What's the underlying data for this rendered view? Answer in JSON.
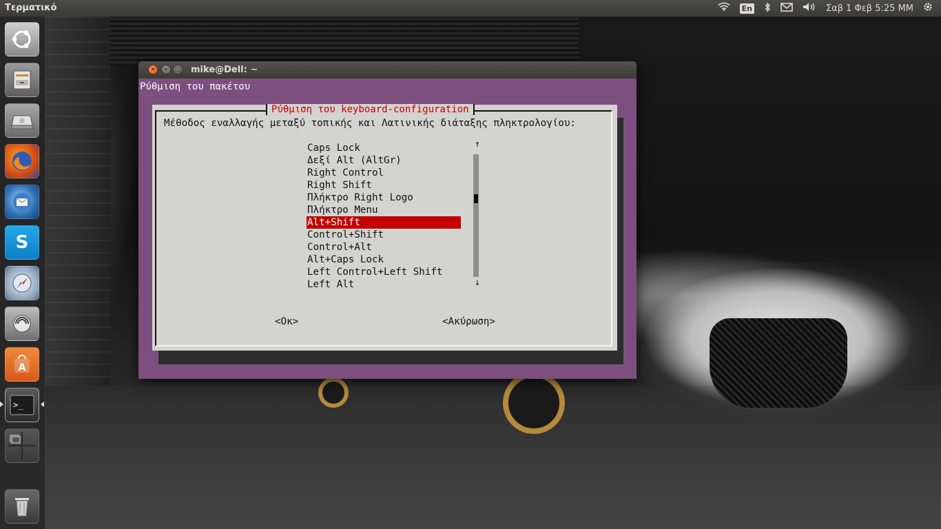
{
  "panel": {
    "app_title": "Τερματικό",
    "language": "En",
    "datetime": "Σαβ 1 Φεβ  5:25 MM"
  },
  "launcher": {
    "items": [
      "dash",
      "files",
      "disks",
      "firefox",
      "thunderbird",
      "skype",
      "safari",
      "software-updater",
      "software-center",
      "terminal",
      "workspace-switcher",
      "trash"
    ]
  },
  "terminal": {
    "title": "mike@Dell: ~",
    "header_text": "Ρύθμιση του πακέτου"
  },
  "dialog": {
    "title": "Ρύθμιση του keyboard-configuration",
    "prompt": "Μέθοδος εναλλαγής μεταξύ τοπικής και Λατινικής διάταξης πληκτρολογίου:",
    "options": [
      "Caps Lock",
      "Δεξί Alt (AltGr)",
      "Right Control",
      "Right Shift",
      "Πλήκτρο Right Logo",
      "Πλήκτρο Menu",
      "Alt+Shift",
      "Control+Shift",
      "Control+Alt",
      "Alt+Caps Lock",
      "Left Control+Left Shift",
      "Left Alt"
    ],
    "selected_index": 6,
    "ok_label": "<Οκ>",
    "cancel_label": "<Ακύρωση>",
    "scroll_up": "↑",
    "scroll_down": "↓"
  },
  "colors": {
    "terminal_bg": "#7c4f7f",
    "dialog_bg": "#d3d3cf",
    "selection": "#c40000",
    "dialog_title": "#c20000"
  }
}
